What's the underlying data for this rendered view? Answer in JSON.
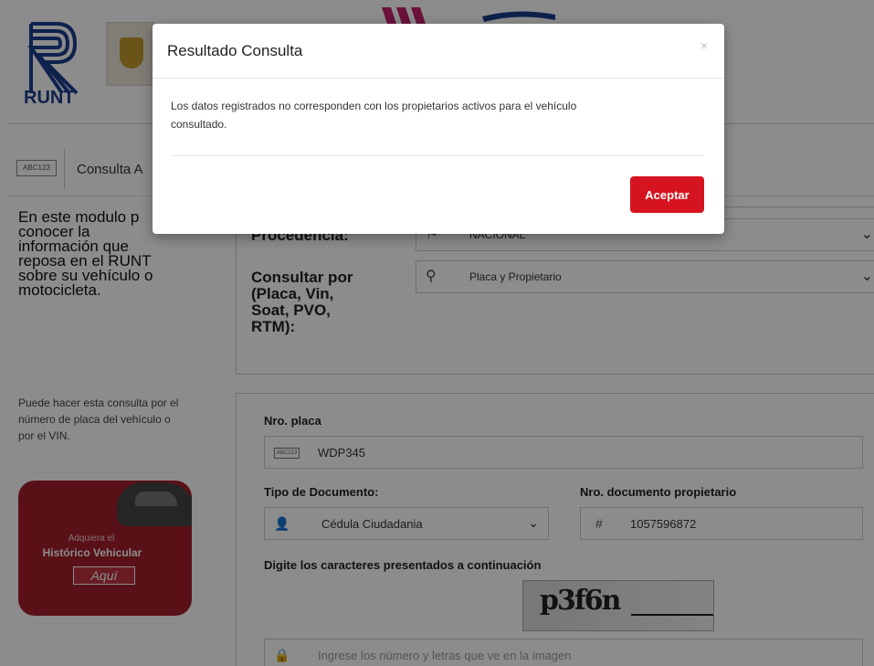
{
  "header": {
    "logo_text": "RUNT"
  },
  "breadcrumb": {
    "icon_text": "ABC123",
    "label": "Consulta A"
  },
  "left": {
    "intro": "En este modulo p conocer la información que reposa en el RUNT sobre su vehículo o motocicleta.",
    "intro_lines": [
      "En este modulo p",
      "conocer la",
      "información que",
      "reposa en el RUNT",
      "sobre su vehículo o",
      "motocicleta."
    ],
    "hint": "Puede hacer esta consulta por el número de placa del vehículo o por el VIN.",
    "promo": {
      "small": "Adquiera el",
      "big": "Histórico Vehicular",
      "button": "Aquí"
    }
  },
  "form_top": {
    "procedencia_label": "Procedencia:",
    "procedencia_value": "NACIONAL",
    "consultar_label": "Consultar por (Placa, Vin, Soat, PVO, RTM):",
    "consultar_lines": [
      "Consultar por",
      "(Placa, Vin,",
      "Soat, PVO,",
      "RTM):"
    ],
    "consultar_value": "Placa y Propietario"
  },
  "form_bottom": {
    "placa_label": "Nro. placa",
    "placa_value": "WDP345",
    "plate_icon_text": "ABC123",
    "tipo_doc_label": "Tipo de Documento:",
    "tipo_doc_value": "Cédula Ciudadania",
    "nro_doc_label": "Nro. documento propietario",
    "nro_doc_value": "1057596872",
    "captcha_label": "Digite los caracteres presentados a continuación",
    "captcha_text": "p3f6n",
    "captcha_placeholder": "Ingrese los número y letras que ve en la imagen"
  },
  "modal": {
    "title": "Resultado Consulta",
    "close": "×",
    "message": "Los datos registrados no corresponden con los propietarios activos para el vehículo consultado.",
    "message_lines": [
      "Los datos registrados no corresponden con los propietarios activos para el vehículo",
      "consultado."
    ],
    "button": "Aceptar"
  },
  "colors": {
    "accent_red": "#d6141f",
    "runt_blue": "#1d3e8f",
    "promo_red": "#a31f2a"
  }
}
